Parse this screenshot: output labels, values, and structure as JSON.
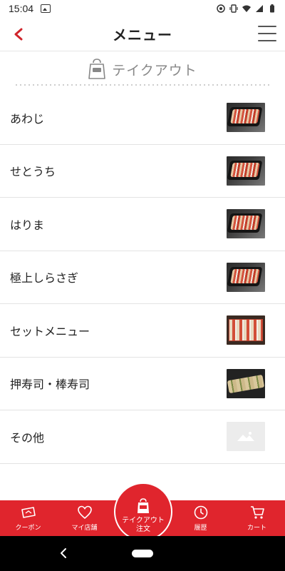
{
  "status_bar": {
    "time": "15:04"
  },
  "header": {
    "title": "メニュー"
  },
  "section": {
    "label": "テイクアウト"
  },
  "menu_items": [
    {
      "label": "あわじ",
      "thumb": "sushi-platter"
    },
    {
      "label": "せとうち",
      "thumb": "sushi-platter"
    },
    {
      "label": "はりま",
      "thumb": "sushi-platter"
    },
    {
      "label": "極上しらさぎ",
      "thumb": "sushi-platter"
    },
    {
      "label": "セットメニュー",
      "thumb": "sushi-box"
    },
    {
      "label": "押寿司・棒寿司",
      "thumb": "sushi-roll"
    },
    {
      "label": "その他",
      "thumb": "no-image-placeholder"
    }
  ],
  "bottom_nav": {
    "coupon": "クーポン",
    "my_store": "マイ店舗",
    "takeout_line1": "テイクアウト",
    "takeout_line2": "注文",
    "history": "履歴",
    "cart": "カート"
  },
  "colors": {
    "accent": "#e0252d",
    "back_arrow": "#d0242b"
  }
}
